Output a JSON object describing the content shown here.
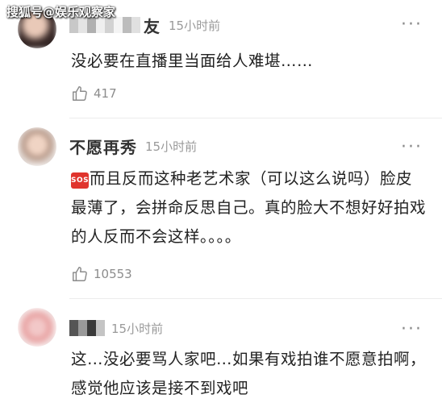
{
  "watermark": "搜狐号@娱乐观察家",
  "comments": [
    {
      "username": "友",
      "time": "15小时前",
      "text": "没必要在直播里当面给人难堪……",
      "likes": "417",
      "more": "···"
    },
    {
      "username": "不愿再秀",
      "time": "15小时前",
      "emoji": "SOS",
      "text": "而且反而这种老艺术家（可以这么说吗）脸皮最薄了，会拼命反思自己。真的脸大不想好好拍戏的人反而不会这样。。。。",
      "likes": "10553",
      "more": "···"
    },
    {
      "username": "",
      "time": "15小时前",
      "text": "这…没必要骂人家吧…如果有戏拍谁不愿意拍啊，感觉他应该是接不到戏吧",
      "more": "···"
    }
  ],
  "colors": {
    "time": "#9a9a9a",
    "likes": "#8c8c8c",
    "sos": "#e0342d"
  }
}
